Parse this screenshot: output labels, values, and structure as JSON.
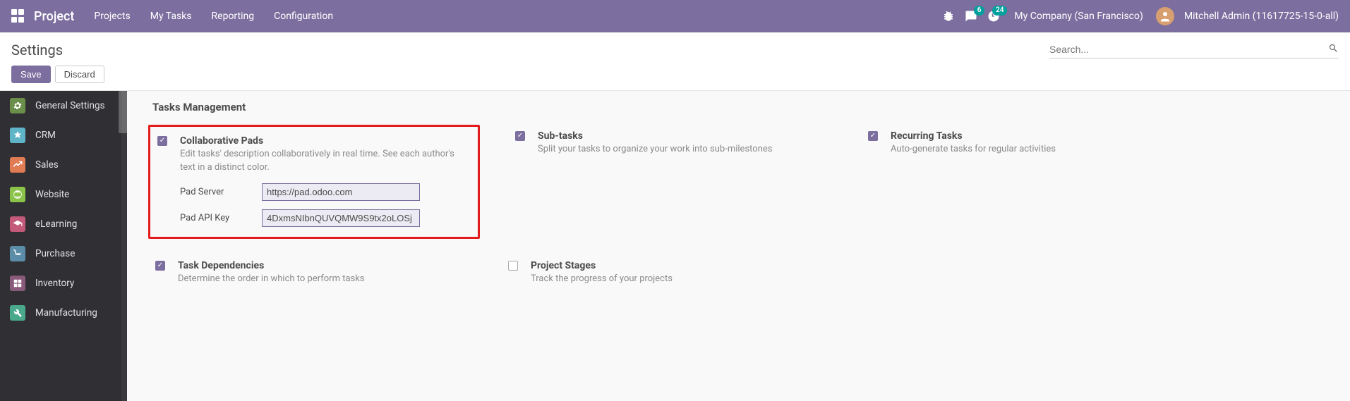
{
  "topnav": {
    "brand": "Project",
    "menu": [
      "Projects",
      "My Tasks",
      "Reporting",
      "Configuration"
    ],
    "chat_badge": "6",
    "activity_badge": "24",
    "company": "My Company (San Francisco)",
    "user": "Mitchell Admin (11617725-15-0-all)"
  },
  "subheader": {
    "title": "Settings",
    "search_placeholder": "Search...",
    "save": "Save",
    "discard": "Discard"
  },
  "sidebar": {
    "items": [
      {
        "label": "General Settings"
      },
      {
        "label": "CRM"
      },
      {
        "label": "Sales"
      },
      {
        "label": "Website"
      },
      {
        "label": "eLearning"
      },
      {
        "label": "Purchase"
      },
      {
        "label": "Inventory"
      },
      {
        "label": "Manufacturing"
      }
    ]
  },
  "section": {
    "title": "Tasks Management",
    "pads": {
      "checked": true,
      "title": "Collaborative Pads",
      "desc": "Edit tasks' description collaboratively in real time. See each author's text in a distinct color.",
      "server_label": "Pad Server",
      "server_value": "https://pad.odoo.com",
      "apikey_label": "Pad API Key",
      "apikey_value": "4DxmsNIbnQUVQMW9S9tx2oLOSj"
    },
    "subtasks": {
      "checked": true,
      "title": "Sub-tasks",
      "desc": "Split your tasks to organize your work into sub-milestones"
    },
    "recurring": {
      "checked": true,
      "title": "Recurring Tasks",
      "desc": "Auto-generate tasks for regular activities"
    },
    "deps": {
      "checked": true,
      "title": "Task Dependencies",
      "desc": "Determine the order in which to perform tasks"
    },
    "stages": {
      "checked": false,
      "title": "Project Stages",
      "desc": "Track the progress of your projects"
    }
  }
}
